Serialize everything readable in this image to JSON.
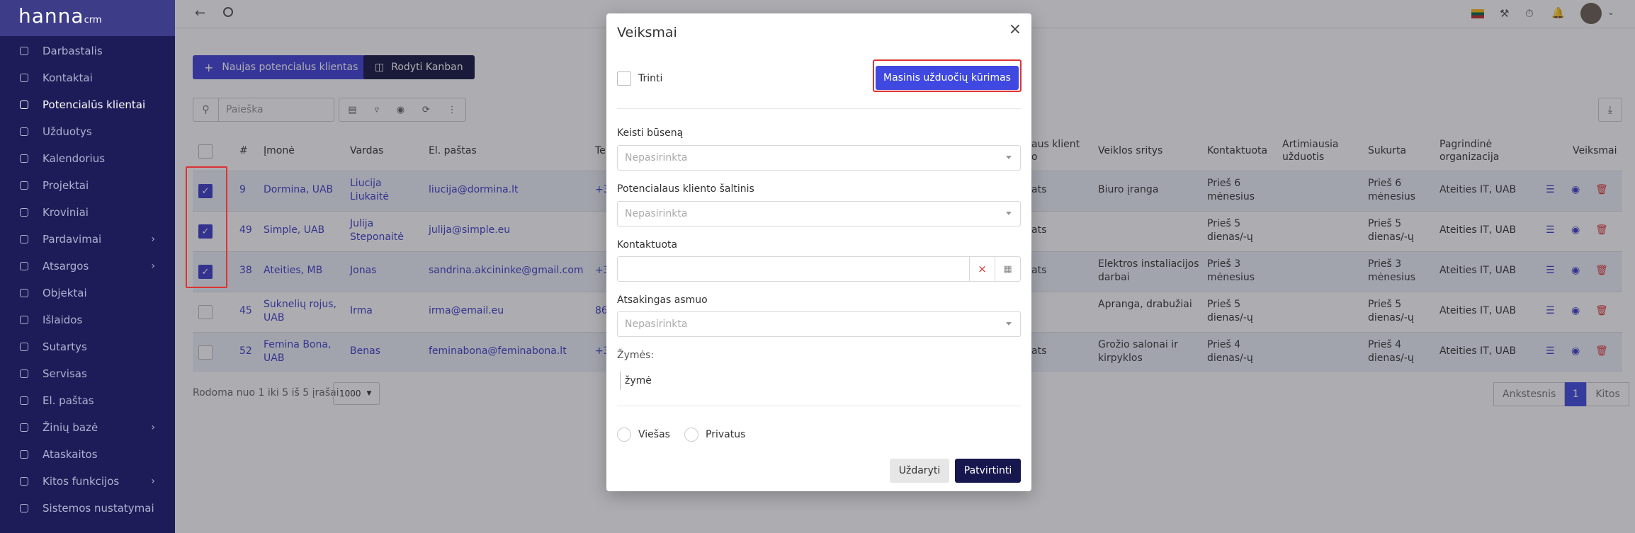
{
  "sidebar": {
    "logo": "hanna",
    "logo_suffix": "crm",
    "items": [
      {
        "label": "Darbastalis",
        "icon": "dashboard-icon"
      },
      {
        "label": "Kontaktai",
        "icon": "contacts-icon"
      },
      {
        "label": "Potencialūs klientai",
        "icon": "leads-icon",
        "active": true
      },
      {
        "label": "Užduotys",
        "icon": "tasks-icon"
      },
      {
        "label": "Kalendorius",
        "icon": "calendar-icon"
      },
      {
        "label": "Projektai",
        "icon": "projects-icon"
      },
      {
        "label": "Kroviniai",
        "icon": "truck-icon"
      },
      {
        "label": "Pardavimai",
        "icon": "sales-icon",
        "has_children": true
      },
      {
        "label": "Atsargos",
        "icon": "inventory-icon",
        "has_children": true
      },
      {
        "label": "Objektai",
        "icon": "building-icon"
      },
      {
        "label": "Išlaidos",
        "icon": "expenses-icon"
      },
      {
        "label": "Sutartys",
        "icon": "contract-icon"
      },
      {
        "label": "Servisas",
        "icon": "service-icon"
      },
      {
        "label": "El. paštas",
        "icon": "mail-icon"
      },
      {
        "label": "Žinių bazė",
        "icon": "folder-icon",
        "has_children": true
      },
      {
        "label": "Ataskaitos",
        "icon": "reports-icon"
      },
      {
        "label": "Kitos funkcijos",
        "icon": "tools-icon",
        "has_children": true
      },
      {
        "label": "Sistemos nustatymai",
        "icon": "gear-icon"
      }
    ]
  },
  "toolbar": {
    "new_lead": "Naujas potencialus klientas",
    "kanban": "Rodyti Kanban",
    "search_placeholder": "Paieška"
  },
  "table": {
    "headers": {
      "num": "#",
      "company": "Įmonė",
      "name": "Vardas",
      "email": "El. paštas",
      "te": "Te",
      "lead_status": "aus klient o",
      "area": "Veiklos sritys",
      "contacted": "Kontaktuota",
      "nearest_task": "Artimiausia užduotis",
      "created": "Sukurta",
      "org": "Pagrindinė organizacija",
      "actions": "Veiksmai"
    },
    "rows": [
      {
        "id": "9",
        "company": "Dormina, UAB",
        "name": "Liucija Liukaitė",
        "email": "liucija@dormina.lt",
        "te": "+3",
        "status": "ats",
        "area": "Biuro įranga",
        "contacted": "Prieš 6 mėnesius",
        "created": "Prieš 6 mėnesius",
        "org": "Ateities IT, UAB",
        "checked": true
      },
      {
        "id": "49",
        "company": "Simple, UAB",
        "name": "Julija Steponaitė",
        "email": "julija@simple.eu",
        "te": "",
        "status": "ats",
        "area": "",
        "contacted": "Prieš 5 dienas/-ų",
        "created": "Prieš 5 dienas/-ų",
        "org": "Ateities IT, UAB",
        "checked": true
      },
      {
        "id": "38",
        "company": "Ateities, MB",
        "name": "Jonas",
        "email": "sandrina.akcininke@gmail.com",
        "te": "+3",
        "status": "ats",
        "area": "Elektros instaliacijos darbai",
        "contacted": "Prieš 3 mėnesius",
        "created": "Prieš 3 mėnesius",
        "org": "Ateities IT, UAB",
        "checked": true
      },
      {
        "id": "45",
        "company": "Suknelių rojus, UAB",
        "name": "Irma",
        "email": "irma@email.eu",
        "te": "86",
        "status": "",
        "area": "Apranga, drabužiai",
        "contacted": "Prieš 5 dienas/-ų",
        "created": "Prieš 5 dienas/-ų",
        "org": "Ateities IT, UAB",
        "checked": false
      },
      {
        "id": "52",
        "company": "Femina Bona, UAB",
        "name": "Benas",
        "email": "feminabona@feminabona.lt",
        "te": "+3",
        "status": "ats",
        "area": "Grožio salonai ir kirpyklos",
        "contacted": "Prieš 4 dienas/-ų",
        "created": "Prieš 4 dienas/-ų",
        "org": "Ateities IT, UAB",
        "checked": false
      }
    ],
    "footer": "Rodoma nuo 1 iki 5 iš 5 įrašai",
    "page_size": "1000",
    "prev": "Ankstesnis",
    "page": "1",
    "next": "Kitos"
  },
  "modal": {
    "title": "Veiksmai",
    "delete_label": "Trinti",
    "mass_tasks": "Masinis užduočių kūrimas",
    "status_label": "Keisti būseną",
    "status_placeholder": "Nepasirinkta",
    "source_label": "Potencialaus kliento šaltinis",
    "source_placeholder": "Nepasirinkta",
    "contacted_label": "Kontaktuota",
    "responsible_label": "Atsakingas asmuo",
    "responsible_placeholder": "Nepasirinkta",
    "tags_label": "Žymės:",
    "tags_placeholder": "žymė",
    "public_label": "Viešas",
    "private_label": "Privatus",
    "close_btn": "Uždaryti",
    "confirm_btn": "Patvirtinti"
  },
  "colors": {
    "sidebar": "#1e1c58",
    "accent": "#3f48e0",
    "dark_btn": "#12123f",
    "highlight": "#dd3333"
  }
}
